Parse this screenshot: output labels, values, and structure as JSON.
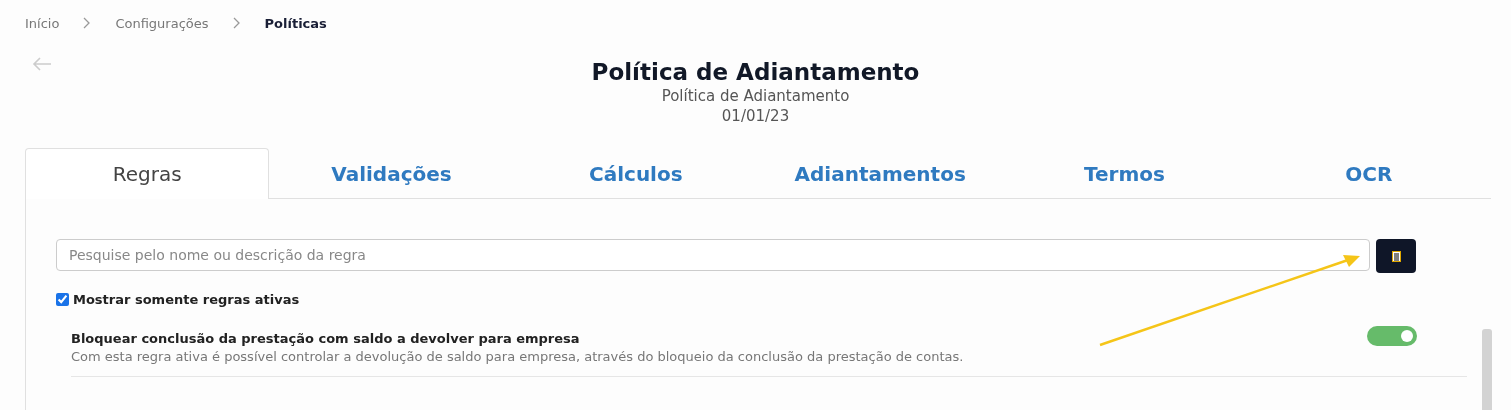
{
  "breadcrumb": [
    {
      "label": "Início",
      "current": false
    },
    {
      "label": "Configurações",
      "current": false
    },
    {
      "label": "Políticas",
      "current": true
    }
  ],
  "header": {
    "title": "Política de Adiantamento",
    "subtitle": "Política de Adiantamento",
    "date": "01/01/23"
  },
  "tabs": [
    {
      "label": "Regras",
      "selected": true
    },
    {
      "label": "Validações",
      "selected": false
    },
    {
      "label": "Cálculos",
      "selected": false
    },
    {
      "label": "Adiantamentos",
      "selected": false
    },
    {
      "label": "Termos",
      "selected": false
    },
    {
      "label": "OCR",
      "selected": false
    }
  ],
  "search": {
    "placeholder": "Pesquise pelo nome ou descrição da regra"
  },
  "filter": {
    "label": "Mostrar somente regras ativas",
    "checked": true
  },
  "rules": [
    {
      "title": "Bloquear conclusão da prestação com saldo a devolver para empresa",
      "description": "Com esta regra ativa é possível controlar a devolução de saldo para empresa, através do bloqueio da conclusão da prestação de contas.",
      "on": true
    }
  ]
}
